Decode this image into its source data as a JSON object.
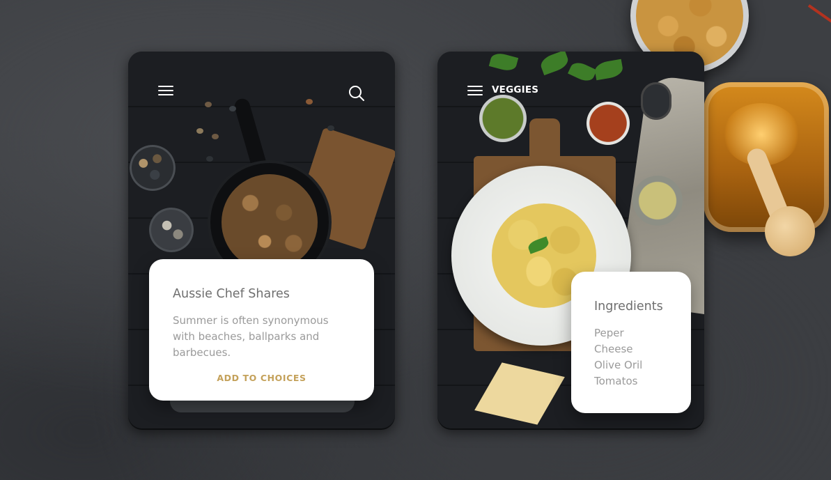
{
  "colors": {
    "accent": "#c4a15a",
    "title_text": "#6e6e6e",
    "body_text": "#9a9a9a",
    "panel_bg": "#ffffff",
    "header_text": "#ffffff"
  },
  "card_left": {
    "menu_icon": "hamburger-menu-icon",
    "search_icon": "search-icon",
    "panel": {
      "title": "Aussie Chef Shares",
      "body": "Summer is often synonymous\nwith beaches, ballparks and\nbarbecues.",
      "action_label": "ADD TO CHOICES"
    }
  },
  "card_right": {
    "menu_icon": "hamburger-menu-icon",
    "nav_title": "VEGGIES",
    "ingredients": {
      "title": "Ingredients",
      "items": [
        "Peper",
        "Cheese",
        "Olive Oril",
        "Tomatos"
      ]
    }
  }
}
